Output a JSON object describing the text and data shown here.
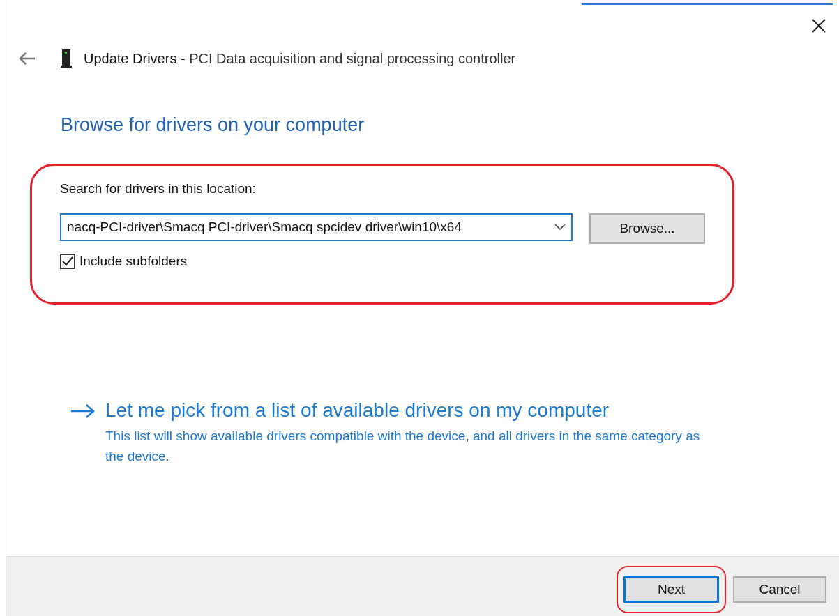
{
  "header": {
    "title": "Update Drivers - ",
    "device": "PCI Data acquisition and signal processing controller"
  },
  "heading": "Browse for drivers on your computer",
  "location": {
    "annotated": true,
    "label": "Search for drivers in this location:",
    "path": "nacq-PCI-driver\\Smacq PCI-driver\\Smacq spcidev driver\\win10\\x64",
    "browse": "Browse...",
    "include_subfolders": {
      "label": "Include subfolders",
      "checked": true
    }
  },
  "pick_link": {
    "title": "Let me pick from a list of available drivers on my computer",
    "description": "This list will show available drivers compatible with the device, and all drivers in the same category as the device."
  },
  "buttons": [
    {
      "label": "Next",
      "focused": true,
      "annotated": true
    },
    {
      "label": "Cancel",
      "focused": false,
      "annotated": false
    }
  ]
}
